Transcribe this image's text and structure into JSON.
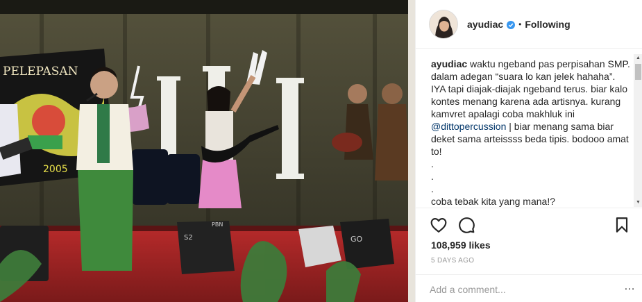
{
  "post": {
    "username": "ayudiac",
    "follow_state": "Following",
    "separator": "•",
    "caption_user": "ayudiac",
    "caption_part1": "waktu ngeband pas perpisahan SMP. dalam adegan “suara lo kan jelek hahaha”. IYA tapi diajak-diajak ngeband terus. biar kalo kontes menang karena ada artisnya. kurang kamvret apalagi coba makhluk ini ",
    "caption_mention": "@dittopercussion",
    "caption_part2": " | biar menang sama biar deket sama arteissss beda tipis. bodooo amat to!\n.\n.\n.\ncoba tebak kita yang mana!?",
    "likes": "108,959 likes",
    "timestamp": "5 DAYS AGO",
    "comment_placeholder": "Add a comment...",
    "more_glyph": "…"
  },
  "photo": {
    "banner_text": "PELEPASAN",
    "banner_year": "2005",
    "speaker_label_left": "S2",
    "speaker_label_center": "PBN",
    "speaker_label_right": "GO"
  },
  "scrollbar": {
    "up_glyph": "▲",
    "down_glyph": "▼"
  },
  "icons": {
    "avatar": "avatar",
    "verified": "verified-badge-icon",
    "like": "heart-icon",
    "comment": "speech-bubble-icon",
    "save": "bookmark-icon"
  },
  "colors": {
    "verified": "#3897f0",
    "mention": "#003569",
    "muted": "#999999",
    "text": "#262626"
  }
}
